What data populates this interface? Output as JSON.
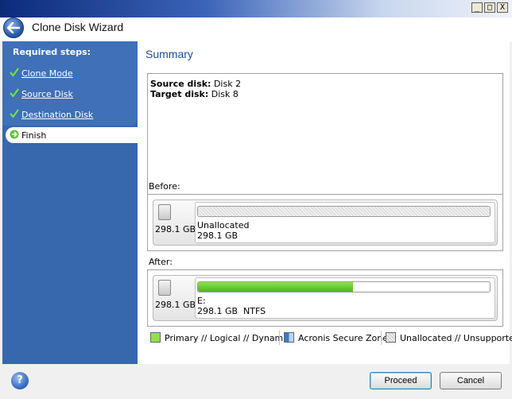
{
  "window": {
    "minimize_glyph": "_",
    "maximize_glyph": "□",
    "close_glyph": "X"
  },
  "header": {
    "title": "Clone Disk Wizard",
    "back_icon": "back-arrow-icon"
  },
  "sidebar": {
    "heading": "Required steps:",
    "items": [
      {
        "label": "Clone Mode",
        "icon": "checkmark-icon"
      },
      {
        "label": "Source Disk",
        "icon": "checkmark-icon"
      },
      {
        "label": "Destination Disk",
        "icon": "checkmark-icon"
      },
      {
        "label": "Finish",
        "icon": "arrow-right-icon"
      }
    ]
  },
  "main": {
    "title": "Summary",
    "source_label": "Source disk:",
    "source_value": "Disk 2",
    "target_label": "Target disk:",
    "target_value": "Disk 8",
    "before": {
      "label": "Before:",
      "disk_size": "298.1 GB",
      "partition_name": "Unallocated",
      "partition_size": "298.1 GB"
    },
    "after": {
      "label": "After:",
      "disk_size": "298.1 GB",
      "partition_name": "E:",
      "partition_size": "298.1 GB  NTFS",
      "used_fraction": 0.53
    }
  },
  "legend": {
    "primary": "Primary // Logical // Dynamic",
    "secure_zone": "Acronis Secure Zone",
    "unallocated": "Unallocated // Unsupported"
  },
  "colors": {
    "accent": "#1e4e9c",
    "sidebar": "#3767ad",
    "primary_partition": "#6ccf2f",
    "secure_zone": "#3a78d4"
  },
  "footer": {
    "help_glyph": "?",
    "proceed": "Proceed",
    "cancel": "Cancel"
  }
}
